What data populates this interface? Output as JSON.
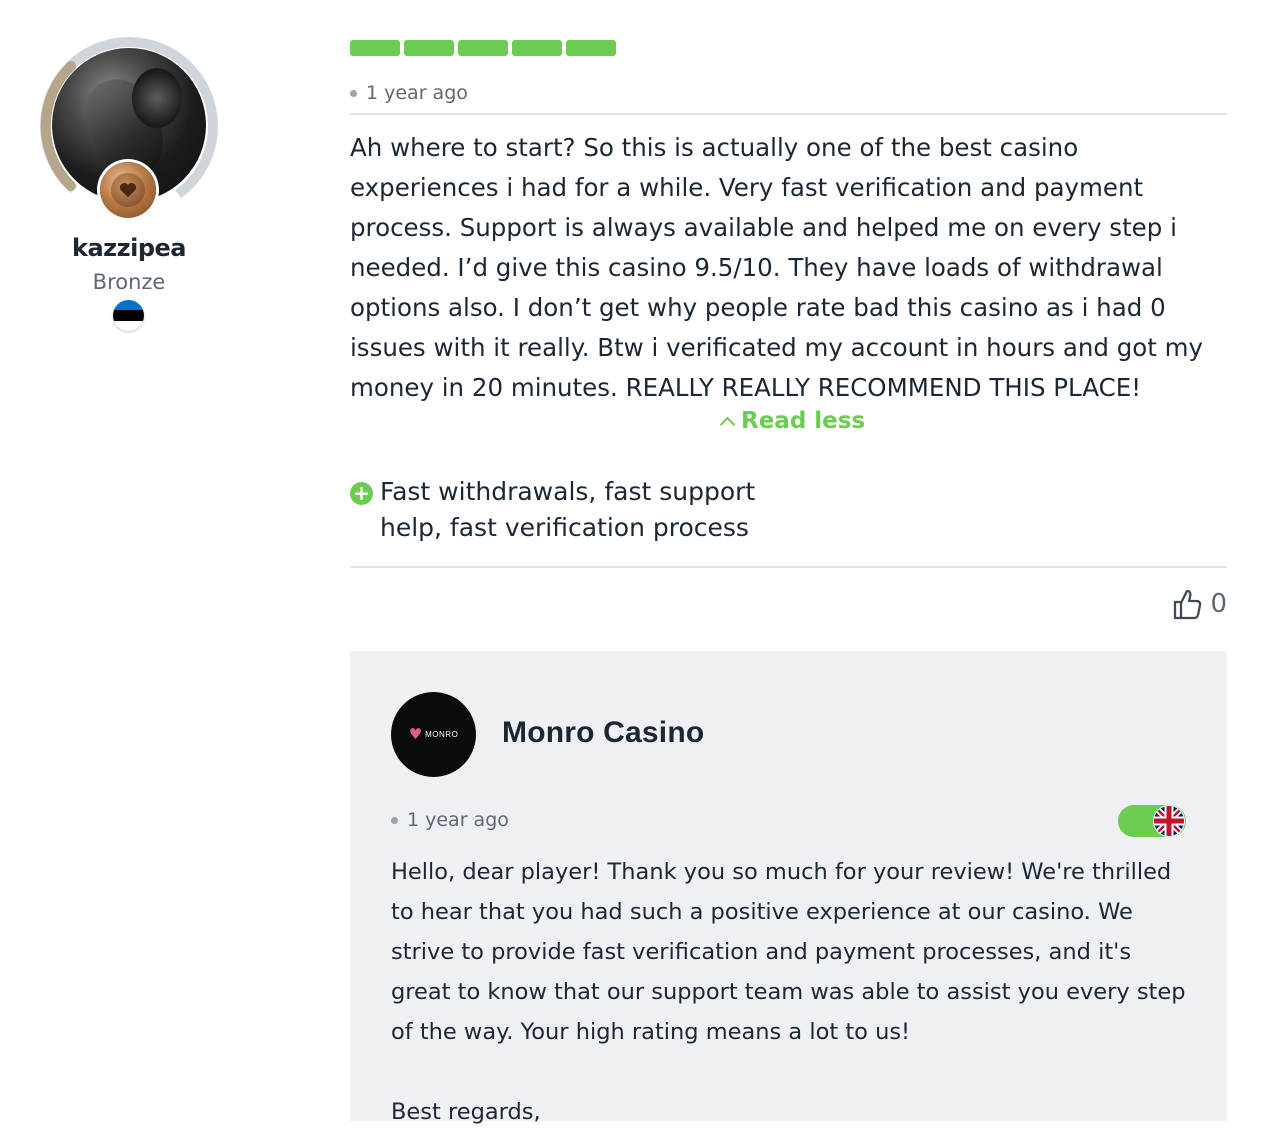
{
  "reviewer": {
    "username": "kazzipea",
    "rank": "Bronze",
    "avatar_icon": "avatar-photo",
    "rank_badge_icon": "bronze-heart-badge-icon",
    "country_flag_icon": "estonia-flag-icon",
    "colors": {
      "ring": "#cfd5da",
      "ring_progress": "#b5a58a",
      "bronze": "#b97a45"
    }
  },
  "review": {
    "rating": {
      "filled": 5,
      "total": 5,
      "color": "#6ccc52"
    },
    "time_ago": "1 year ago",
    "text": "Ah where to start? So this is actually one of the best casino experiences i had for a while. Very fast verification and payment process. Support is always available and helped me on every step i needed. I’d give this casino 9.5/10. They have loads of withdrawal options also. I don’t get why people rate bad this casino as i had 0 issues with it really. Btw i verificated my account in hours and got my money in 20 minutes. REALLY REALLY RECOMMEND THIS PLACE!",
    "read_less_label": "Read less",
    "pros": [
      {
        "icon": "plus-icon",
        "text": "Fast withdrawals, fast support help, fast verification process"
      }
    ],
    "likes": "0",
    "like_icon": "thumbs-up-icon"
  },
  "reply": {
    "brand_name": "Monro Casino",
    "logo_text": "MONRO",
    "time_ago": "1 year ago",
    "translate_flag_icon": "uk-flag-icon",
    "text": "Hello, dear player! Thank you so much for your review! We're thrilled to hear that you had such a positive experience at our casino. We strive to provide fast verification and payment processes, and it's great to know that our support team was able to assist you every step of the way. Your high rating means a lot to us!",
    "signoff": "Best regards,"
  }
}
